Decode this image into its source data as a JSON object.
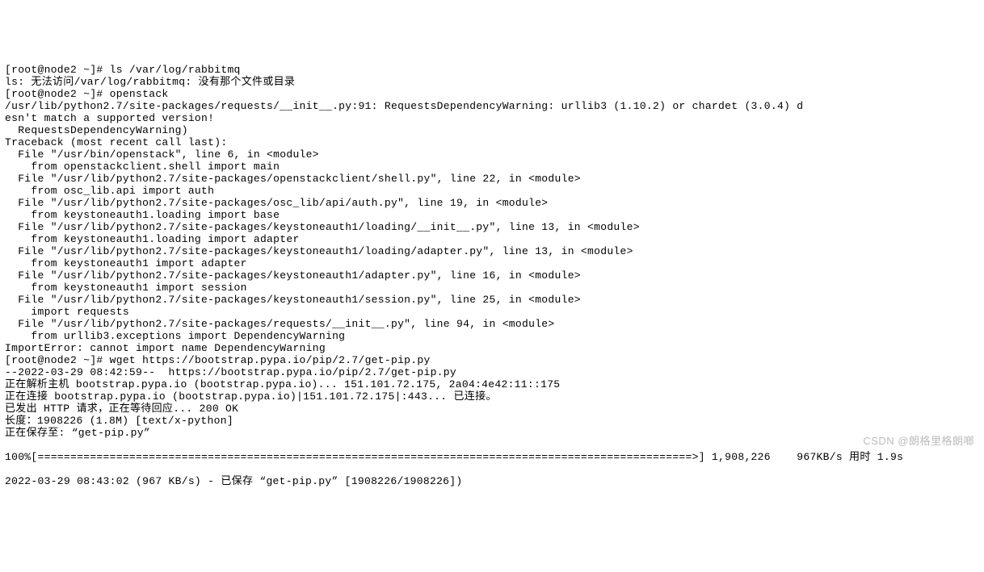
{
  "prompt1": "[root@node2 ~]# ",
  "cmd1": "ls /var/log/rabbitmq",
  "ls_error": "ls: 无法访问/var/log/rabbitmq: 没有那个文件或目录",
  "prompt2": "[root@node2 ~]# ",
  "cmd2": "openstack",
  "warn1": "/usr/lib/python2.7/site-packages/requests/__init__.py:91: RequestsDependencyWarning: urllib3 (1.10.2) or chardet (3.0.4) d",
  "warn2": "esn't match a supported version!",
  "warn3": "  RequestsDependencyWarning)",
  "tb0": "Traceback (most recent call last):",
  "tb1a": "  File \"/usr/bin/openstack\", line 6, in <module>",
  "tb1b": "    from openstackclient.shell import main",
  "tb2a": "  File \"/usr/lib/python2.7/site-packages/openstackclient/shell.py\", line 22, in <module>",
  "tb2b": "    from osc_lib.api import auth",
  "tb3a": "  File \"/usr/lib/python2.7/site-packages/osc_lib/api/auth.py\", line 19, in <module>",
  "tb3b": "    from keystoneauth1.loading import base",
  "tb4a": "  File \"/usr/lib/python2.7/site-packages/keystoneauth1/loading/__init__.py\", line 13, in <module>",
  "tb4b": "    from keystoneauth1.loading import adapter",
  "tb5a": "  File \"/usr/lib/python2.7/site-packages/keystoneauth1/loading/adapter.py\", line 13, in <module>",
  "tb5b": "    from keystoneauth1 import adapter",
  "tb6a": "  File \"/usr/lib/python2.7/site-packages/keystoneauth1/adapter.py\", line 16, in <module>",
  "tb6b": "    from keystoneauth1 import session",
  "tb7a": "  File \"/usr/lib/python2.7/site-packages/keystoneauth1/session.py\", line 25, in <module>",
  "tb7b": "    import requests",
  "tb8a": "  File \"/usr/lib/python2.7/site-packages/requests/__init__.py\", line 94, in <module>",
  "tb8b": "    from urllib3.exceptions import DependencyWarning",
  "imp_err": "ImportError: cannot import name DependencyWarning",
  "prompt3": "[root@node2 ~]# ",
  "cmd3": "wget https://bootstrap.pypa.io/pip/2.7/get-pip.py",
  "wget1": "--2022-03-29 08:42:59--  https://bootstrap.pypa.io/pip/2.7/get-pip.py",
  "wget2": "正在解析主机 bootstrap.pypa.io (bootstrap.pypa.io)... 151.101.72.175, 2a04:4e42:11::175",
  "wget3": "正在连接 bootstrap.pypa.io (bootstrap.pypa.io)|151.101.72.175|:443... 已连接。",
  "wget4": "已发出 HTTP 请求，正在等待回应... 200 OK",
  "wget5": "长度：1908226 (1.8M) [text/x-python]",
  "wget6": "正在保存至: “get-pip.py”",
  "blank": "",
  "progress": "100%[====================================================================================================>] 1,908,226    967KB/s 用时 1.9s",
  "wget_end": "2022-03-29 08:43:02 (967 KB/s) - 已保存 “get-pip.py” [1908226/1908226])",
  "watermark": "CSDN @朗格里格朗啷"
}
